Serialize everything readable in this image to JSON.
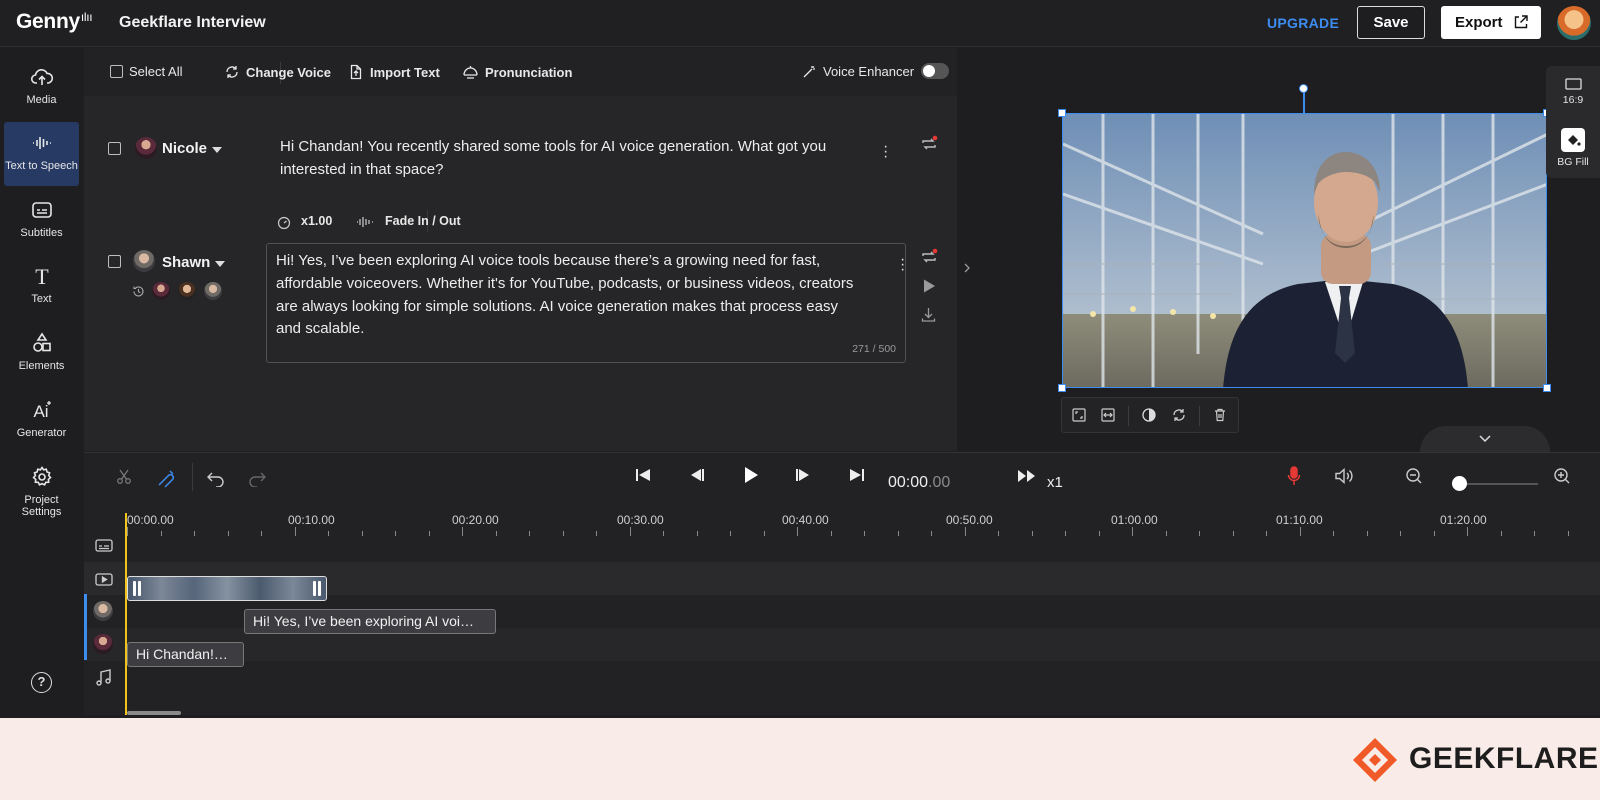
{
  "app": {
    "logo": "Genny",
    "project_title": "Geekflare Interview",
    "upgrade_label": "UPGRADE",
    "save_label": "Save",
    "export_label": "Export",
    "accent_color": "#3d8cf0"
  },
  "sidebar": {
    "items": [
      {
        "label": "Media",
        "icon": "upload-cloud-icon"
      },
      {
        "label": "Text to Speech",
        "icon": "waveform-icon",
        "active": true
      },
      {
        "label": "Subtitles",
        "icon": "subtitles-icon"
      },
      {
        "label": "Text",
        "icon": "text-T-icon"
      },
      {
        "label": "Elements",
        "icon": "shapes-icon"
      },
      {
        "label": "Generator",
        "icon": "ai-generator-icon"
      },
      {
        "label": "Project Settings",
        "icon": "gear-icon"
      }
    ],
    "help": "?"
  },
  "editor": {
    "toolbar": {
      "select_all": "Select All",
      "change_voice": "Change Voice",
      "import_text": "Import Text",
      "pronunciation": "Pronunciation",
      "voice_enhancer": "Voice Enhancer",
      "voice_enhancer_on": false
    },
    "blocks": [
      {
        "speaker": "Nicole",
        "text": "Hi Chandan! You recently shared some tools for AI voice generation. What got you interested in that space?"
      },
      {
        "speaker": "Shawn",
        "speed": "x1.00",
        "fade": "Fade In / Out",
        "text": "Hi! Yes, I’ve been exploring AI voice tools because there’s a growing need for fast, affordable voiceovers. Whether it's for YouTube, podcasts, or business videos, creators are always looking for simple solutions. AI voice generation makes that process easy and scalable.",
        "char_count": "271 / 500"
      }
    ]
  },
  "preview": {
    "aspect_label": "16:9",
    "bg_fill_label": "BG Fill"
  },
  "timeline": {
    "time_current": "00:00",
    "time_fraction": ".00",
    "speed": "x1",
    "ruler": [
      "00:00.00",
      "00:10.00",
      "00:20.00",
      "00:30.00",
      "00:40.00",
      "00:50.00",
      "01:00.00",
      "01:10.00",
      "01:20.00"
    ],
    "clips": {
      "shawn": "Hi! Yes, I’ve been exploring AI voi…",
      "nicole": "Hi Chandan!…"
    }
  },
  "footer": {
    "brand": "GEEKFLARE"
  }
}
